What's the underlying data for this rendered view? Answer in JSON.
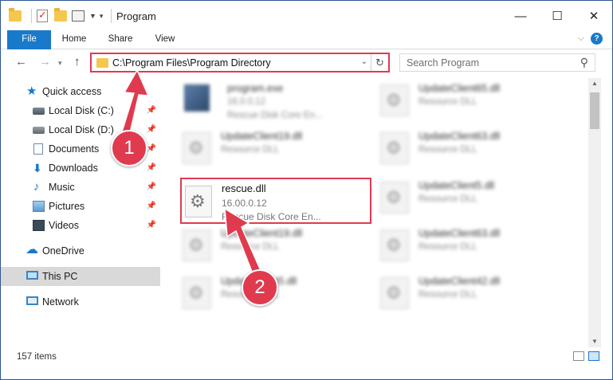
{
  "window": {
    "title": "Program",
    "buttons": {
      "minimize": "—",
      "maximize": "☐",
      "close": "✕"
    }
  },
  "ribbon": {
    "tabs": [
      "File",
      "Home",
      "Share",
      "View"
    ],
    "help": "?"
  },
  "nav": {
    "address": "C:\\Program Files\\Program Directory",
    "search_placeholder": "Search Program"
  },
  "sidebar": {
    "items": [
      {
        "label": "Quick access",
        "icon": "star-icon"
      },
      {
        "label": "Local Disk (C:)",
        "icon": "disk-icon"
      },
      {
        "label": "Local Disk (D:)",
        "icon": "disk-icon"
      },
      {
        "label": "Documents",
        "icon": "documents-icon"
      },
      {
        "label": "Downloads",
        "icon": "downloads-icon"
      },
      {
        "label": "Music",
        "icon": "music-icon"
      },
      {
        "label": "Pictures",
        "icon": "pictures-icon"
      },
      {
        "label": "Videos",
        "icon": "videos-icon"
      },
      {
        "label": "OneDrive",
        "icon": "onedrive-icon"
      },
      {
        "label": "This PC",
        "icon": "this-pc-icon"
      },
      {
        "label": "Network",
        "icon": "network-icon"
      }
    ]
  },
  "files": {
    "left": [
      {
        "name": "program.exe",
        "version": "16.0.0.12",
        "desc": "Rescue Disk Core En..."
      },
      {
        "name": "UpdateClient19.dll",
        "desc": "Resource DLL"
      },
      {
        "name": "rescue.dll",
        "version": "16.00.0.12",
        "desc": "Rescue Disk Core En..."
      },
      {
        "name": "UpdateClient19.dll",
        "desc": "Resource DLL"
      },
      {
        "name": "UpdateClient5.dll",
        "desc": "Resource DLL"
      }
    ],
    "right": [
      {
        "name": "UpdateClient65.dll",
        "desc": "Resource DLL"
      },
      {
        "name": "UpdateClient63.dll",
        "desc": "Resource DLL"
      },
      {
        "name": "UpdateClient5.dll",
        "desc": "Resource DLL"
      },
      {
        "name": "UpdateClient63.dll",
        "desc": "Resource DLL"
      },
      {
        "name": "UpdateClient42.dll",
        "desc": "Resource DLL"
      }
    ]
  },
  "status": {
    "count": "157 items"
  },
  "annotations": {
    "step1": "1",
    "step2": "2"
  },
  "colors": {
    "accent": "#1979ca",
    "highlight": "#e03a4f"
  }
}
